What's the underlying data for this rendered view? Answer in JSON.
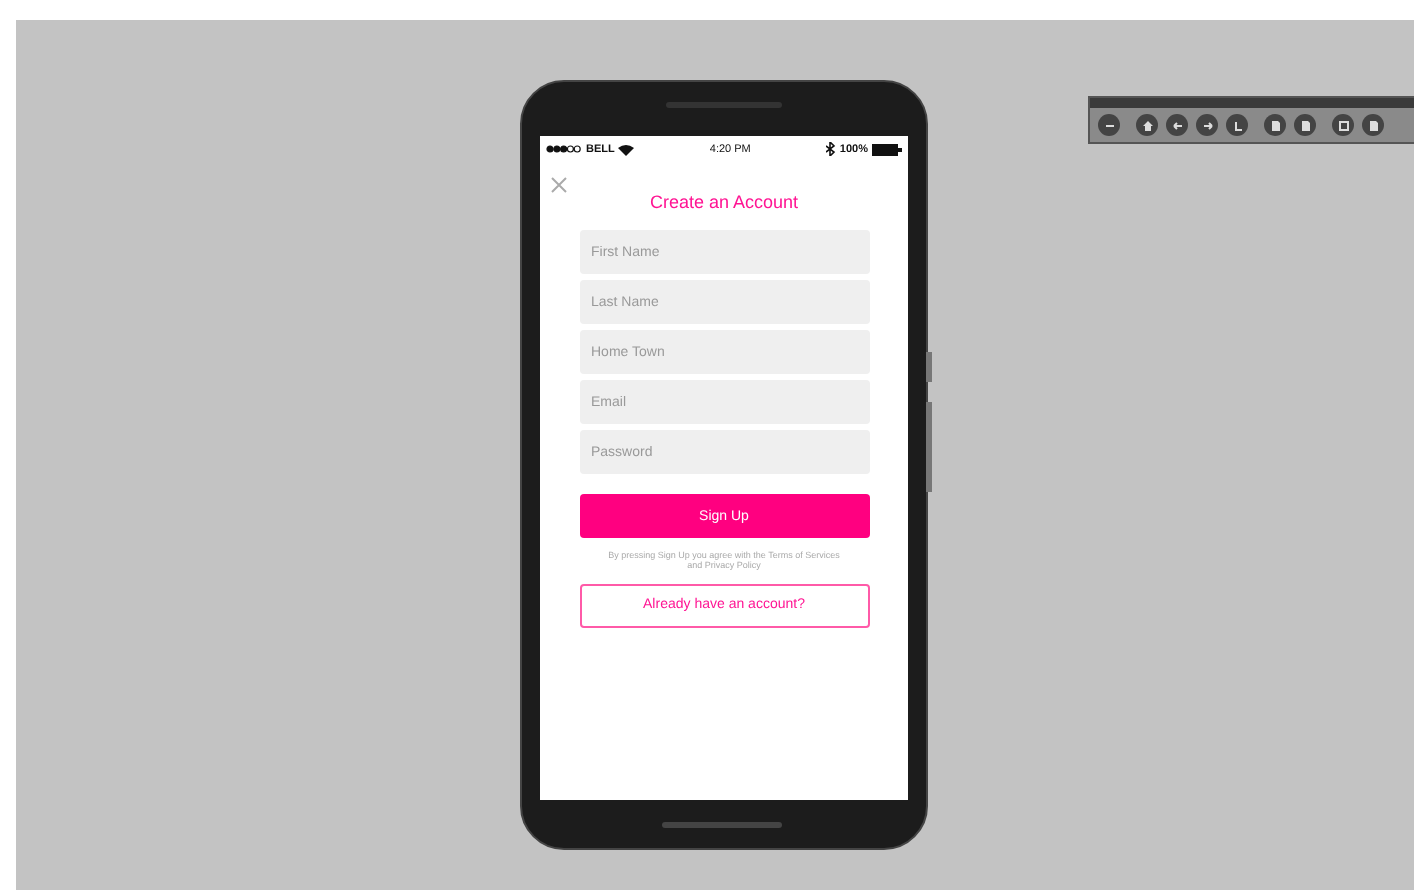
{
  "status_bar": {
    "carrier": "BELL",
    "time": "4:20 PM",
    "battery": "100%"
  },
  "title": "Create an Account",
  "fields": [
    {
      "placeholder": "First Name"
    },
    {
      "placeholder": "Last Name"
    },
    {
      "placeholder": "Home Town"
    },
    {
      "placeholder": "Email"
    },
    {
      "placeholder": "Password"
    }
  ],
  "signup_button": "Sign Up",
  "terms": "By pressing Sign Up you agree with the Terms of Services and Privacy Policy",
  "login_button": "Already have an account?",
  "toolbar": {
    "buttons": [
      {
        "kind": "minus"
      },
      {
        "kind": "home"
      },
      {
        "kind": "left"
      },
      {
        "kind": "right"
      },
      {
        "kind": "back"
      },
      {
        "kind": "page"
      },
      {
        "kind": "page"
      },
      {
        "kind": "square"
      },
      {
        "kind": "page"
      }
    ]
  }
}
